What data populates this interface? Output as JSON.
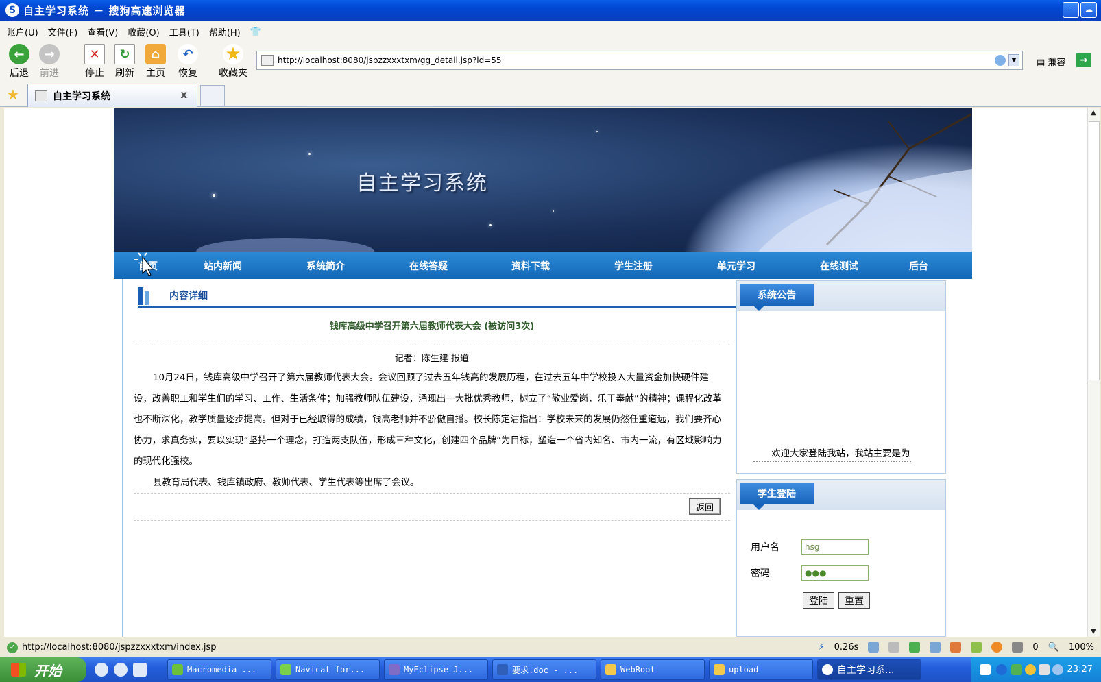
{
  "browser": {
    "window_title": "自主学习系统 － 搜狗高速浏览器",
    "logo": "S",
    "menu": [
      "账户(U)",
      "文件(F)",
      "查看(V)",
      "收藏(O)",
      "工具(T)",
      "帮助(H)"
    ],
    "toolbar": {
      "back": "后退",
      "forward": "前进",
      "stop": "停止",
      "refresh": "刷新",
      "home": "主页",
      "restore": "恢复",
      "favorites": "收藏夹"
    },
    "address": "http://localhost:8080/jspzzxxxtxm/gg_detail.jsp?id=55",
    "compat_label": "兼容",
    "tab_title": "自主学习系统",
    "tab_close": "x",
    "status_url": "http://localhost:8080/jspzzxxxtxm/index.jsp",
    "status_time": "0.26s",
    "status_count": "0",
    "zoom": "100%"
  },
  "site": {
    "banner_title": "自主学习系统",
    "nav": [
      "首页",
      "站内新闻",
      "系统简介",
      "在线答疑",
      "资料下载",
      "学生注册",
      "单元学习",
      "在线测试",
      "后台"
    ],
    "content_header": "内容详细",
    "article_title": "钱库高级中学召开第六届教师代表大会 (被访问3次)",
    "byline": "记者：陈生建 报道",
    "paragraphs": [
      "10月24日，钱库高级中学召开了第六届教师代表大会。会议回顾了过去五年钱高的发展历程，在过去五年中学校投入大量资金加快硬件建设，改善职工和学生们的学习、工作、生活条件；加强教师队伍建设，涌现出一大批优秀教师，树立了“敬业爱岗，乐于奉献”的精神；课程化改革也不断深化，教学质量逐步提高。但对于已经取得的成绩，钱高老师并不骄傲自播。校长陈定沽指出：学校未来的发展仍然任重道远，我们要齐心协力，求真务实，要以实现“坚持一个理念，打造两支队伍，形成三种文化，创建四个品牌”为目标，塑造一个省内知名、市内一流，有区域影响力的现代化强校。",
      "县教育局代表、钱库镇政府、教师代表、学生代表等出席了会议。"
    ],
    "back_button": "返回",
    "notice_header": "系统公告",
    "notice_text": "欢迎大家登陆我站，我站主要是为",
    "login_header": "学生登陆",
    "username_label": "用户名",
    "username_value": "hsg",
    "password_label": "密码",
    "password_value": "●●●",
    "login_button": "登陆",
    "reset_button": "重置"
  },
  "taskbar": {
    "start": "开始",
    "tasks": [
      "Macromedia ...",
      "Navicat for...",
      "MyEclipse J...",
      "要求.doc - ...",
      "WebRoot",
      "upload",
      "自主学习系..."
    ],
    "clock": "23:27"
  },
  "colors": {
    "nav_bg": "#1468b8",
    "title_bar": "#0046d2",
    "article_title": "#2f5a2a"
  }
}
